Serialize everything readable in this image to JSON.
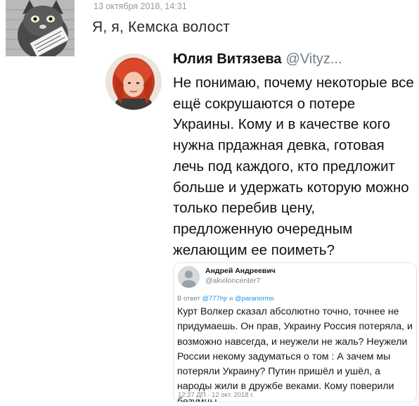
{
  "post": {
    "date": "13 октября 2018, 14:31",
    "text": "Я, я, Кемска волост",
    "avatar_icon": "cat-with-sign-avatar"
  },
  "tweet": {
    "author_name": "Юлия Витязева",
    "author_handle": "@Vityz...",
    "avatar_icon": "red-haired-woman-avatar",
    "text": "Не понимаю, почему некоторые все ещё сокрушаются о потере Украины. Кому и в качестве кого нужна прдажная девка, готовая лечь под каждого, кто предложит больше и удержать которую можно только перебив цену, предложенную очередным желающим ее поиметь?"
  },
  "embedded_tweet": {
    "author_name": "Андрей Андреевич",
    "author_handle": "@akviloncenter7",
    "reply_prefix": "В ответ",
    "reply_mention_1": "@777hjr",
    "reply_and": "и",
    "reply_mention_2": "@paranormo",
    "text": "Курт Волкер сказал абсолютно точно, точнее не придумаешь. Он прав, Украину Россия потеряла, и возможно навсегда, и неужели не жаль? Неужели России некому задуматься о том : А зачем мы потеряли Украину? Путин пришёл и ушёл, а народы жили в дружбе веками. Кому поверили безумцы.",
    "time": "12:27 ДП · 12 окт. 2018 г.",
    "avatar_icon": "default-user-avatar"
  },
  "colors": {
    "handle_gray": "#6f7b86",
    "mention_blue": "#1b95e0",
    "date_gray": "#9a9a9a"
  }
}
